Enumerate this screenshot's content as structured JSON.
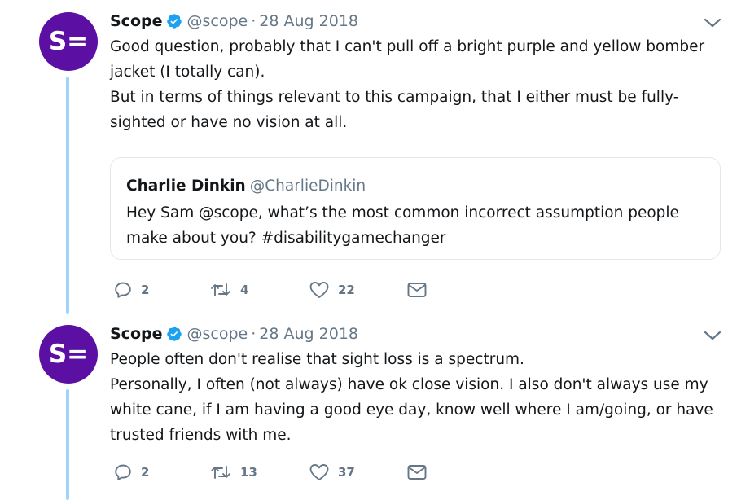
{
  "colors": {
    "avatar_bg": "#5b0fa3",
    "thread_line": "#9fd4ff",
    "verified": "#1da1f2",
    "muted": "#657786",
    "border": "#e1e8ed"
  },
  "tweets": [
    {
      "avatar_text": "S=",
      "name": "Scope",
      "handle": "@scope",
      "separator": "·",
      "date": "28 Aug 2018",
      "lines": [
        "Good question, probably that I can't pull off a bright purple and yellow bomber jacket (I totally can).",
        "But in terms of things relevant to this campaign, that I either must be fully-sighted or have no vision at all."
      ],
      "quote": {
        "name": "Charlie Dinkin",
        "handle": "@CharlieDinkin",
        "text": "Hey Sam @scope, what’s the most common incorrect assumption people make about you? #disabilitygamechanger"
      },
      "replies": "2",
      "retweets": "4",
      "likes": "22"
    },
    {
      "avatar_text": "S=",
      "name": "Scope",
      "handle": "@scope",
      "separator": "·",
      "date": "28 Aug 2018",
      "lines": [
        "People often don't realise that sight loss is a spectrum.",
        "Personally, I often (not always) have ok close vision. I also don't always use my white cane, if I am having a good eye day, know well where I am/going, or have trusted friends with me."
      ],
      "replies": "2",
      "retweets": "13",
      "likes": "37"
    }
  ]
}
